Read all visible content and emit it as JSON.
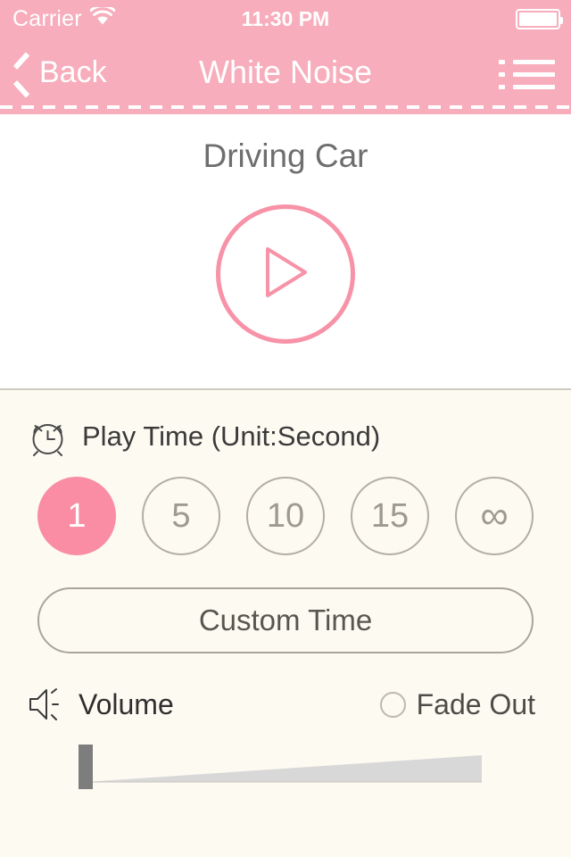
{
  "status_bar": {
    "carrier": "Carrier",
    "wifi_icon": "wifi-icon",
    "time": "11:30 PM",
    "battery_icon": "battery-full-icon"
  },
  "nav_bar": {
    "back_label": "Back",
    "back_icon": "chevron-left-icon",
    "title": "White Noise",
    "menu_icon": "list-menu-icon"
  },
  "player": {
    "sound_name": "Driving Car",
    "play_icon": "play-triangle-icon",
    "state": "paused"
  },
  "play_time": {
    "icon": "alarm-clock-icon",
    "label": "Play Time (Unit:Second)",
    "options": [
      {
        "label": "1",
        "selected": true
      },
      {
        "label": "5",
        "selected": false
      },
      {
        "label": "10",
        "selected": false
      },
      {
        "label": "15",
        "selected": false
      },
      {
        "label": "∞",
        "selected": false
      }
    ],
    "custom_label": "Custom Time"
  },
  "volume": {
    "icon": "speaker-icon",
    "label": "Volume",
    "fade_out_label": "Fade Out",
    "fade_out_checked": false,
    "level_percent": 0
  },
  "colors": {
    "brand_pink": "#f7adbb",
    "accent_pink": "#fa8da3",
    "panel_cream": "#fdfaf2",
    "text_gray": "#6e6e6e",
    "track_gray": "#d8d8d8"
  }
}
